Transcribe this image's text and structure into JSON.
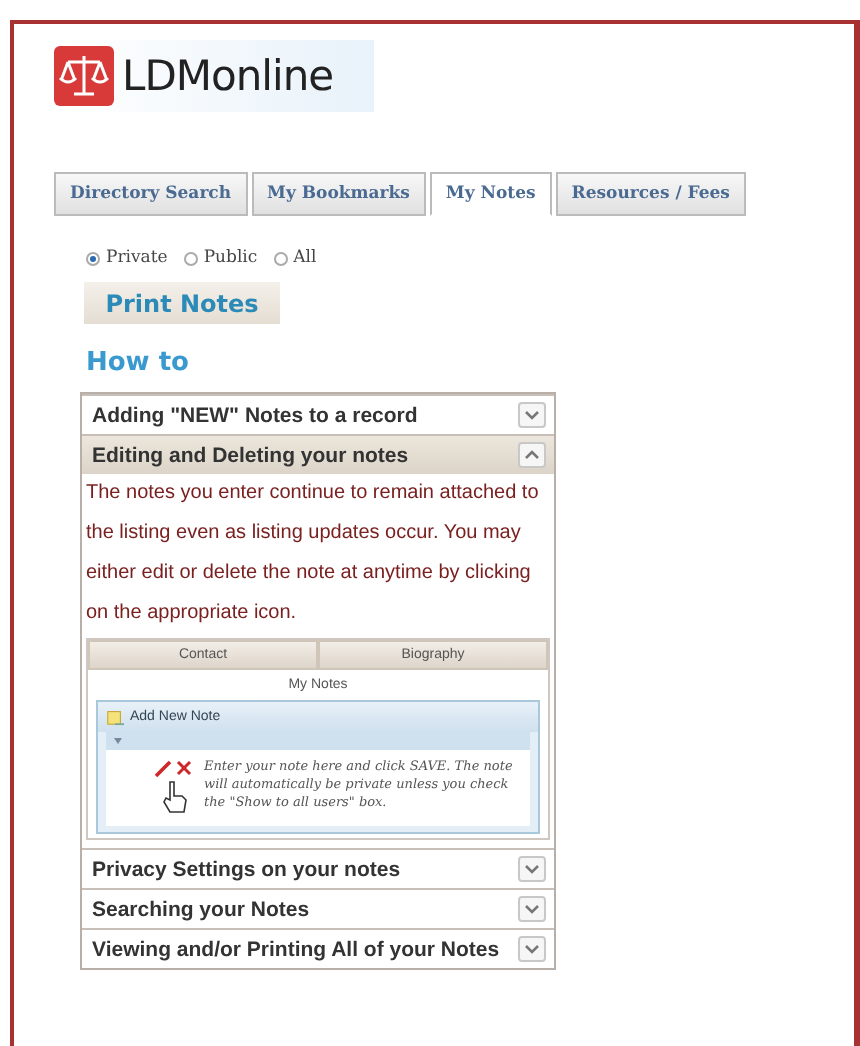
{
  "logo": {
    "text": "LDMonline"
  },
  "tabs": [
    {
      "label": "Directory Search",
      "selected": false
    },
    {
      "label": "My Bookmarks",
      "selected": false
    },
    {
      "label": "My Notes",
      "selected": true
    },
    {
      "label": "Resources / Fees",
      "selected": false
    }
  ],
  "visibility_options": [
    {
      "label": "Private",
      "selected": true
    },
    {
      "label": "Public",
      "selected": false
    },
    {
      "label": "All",
      "selected": false
    }
  ],
  "print_button": "Print Notes",
  "section_title": "How to",
  "accordion": [
    {
      "title": "Adding \"NEW\" Notes to a record",
      "expanded": false
    },
    {
      "title": "Editing and Deleting your notes",
      "expanded": true,
      "body": "The notes you enter continue to remain attached to the listing even as listing updates occur. You may either edit or delete the note at anytime by clicking on the appropriate icon.",
      "example": {
        "tabs": [
          "Contact",
          "Biography"
        ],
        "heading": "My Notes",
        "add_button": "Add New Note",
        "note_text": "Enter your note here and click SAVE. The note will automatically be private unless you check the \"Show to all users\" box."
      }
    },
    {
      "title": "Privacy Settings on your notes",
      "expanded": false
    },
    {
      "title": "Searching your Notes",
      "expanded": false
    },
    {
      "title": "Viewing and/or Printing All of your Notes",
      "expanded": false
    }
  ]
}
